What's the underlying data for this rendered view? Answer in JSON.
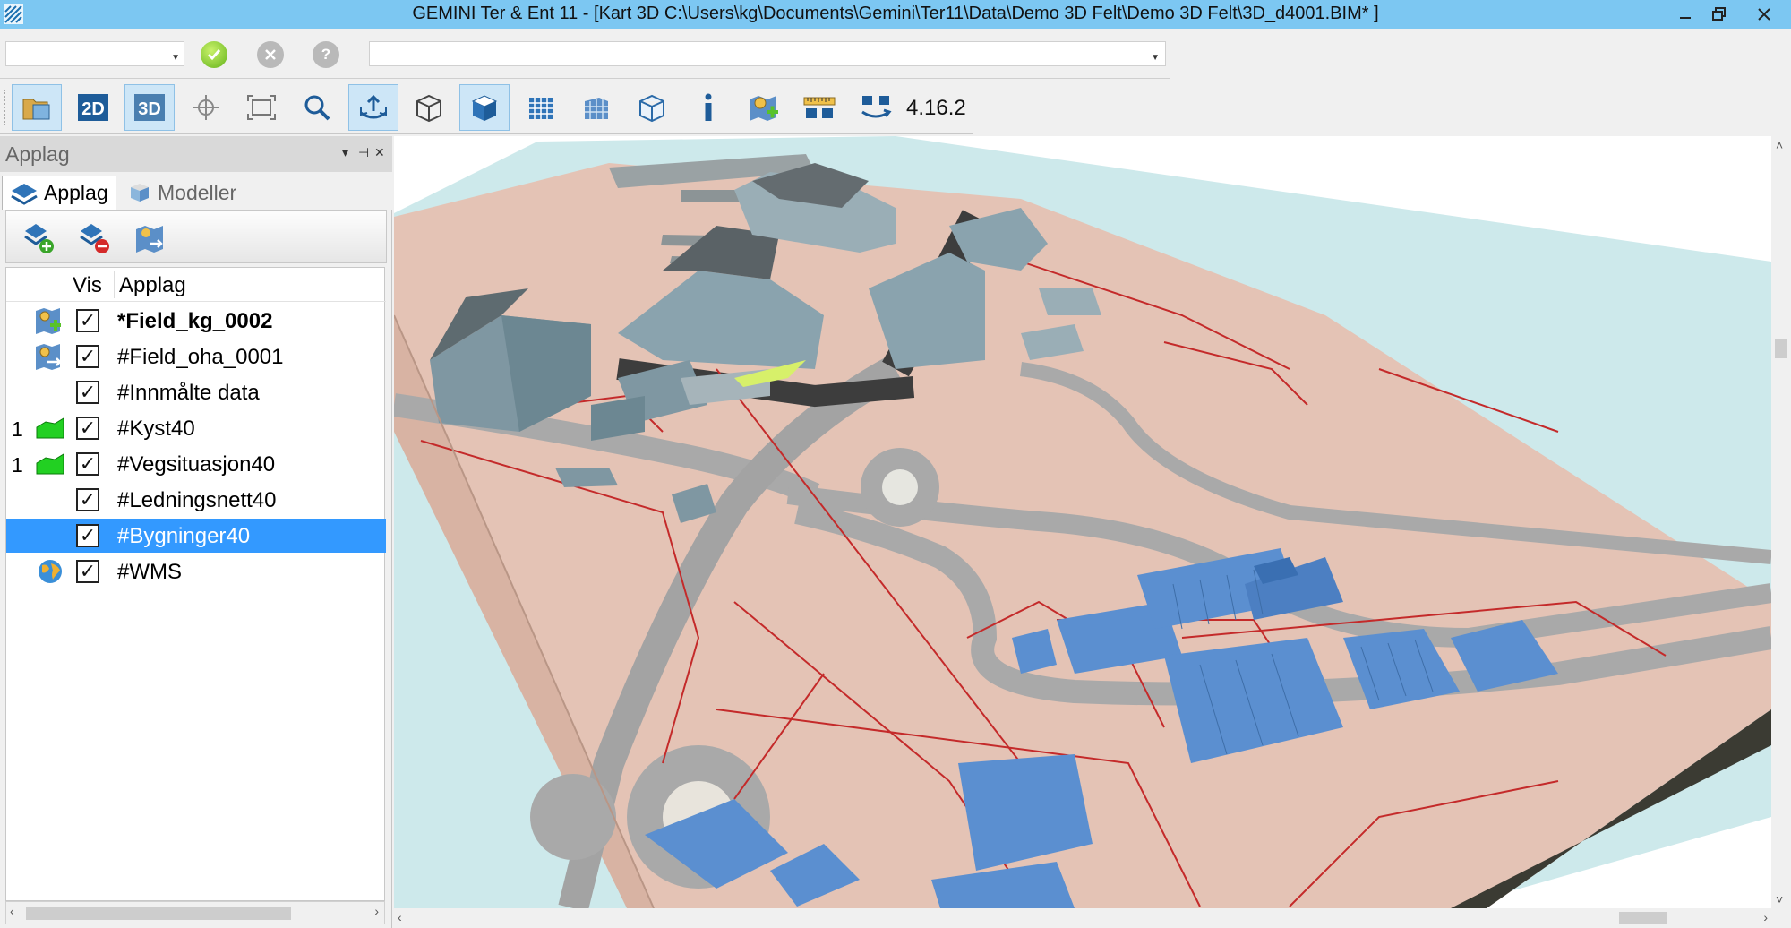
{
  "window": {
    "title": "GEMINI Ter & Ent 11 - [Kart  3D  C:\\Users\\kg\\Documents\\Gemini\\Ter11\\Data\\Demo 3D Felt\\Demo 3D Felt\\3D_d4001.BIM* ]",
    "controls": [
      "minimize",
      "restore",
      "close"
    ]
  },
  "command_bar": {
    "combo_value": "",
    "input_value": ""
  },
  "toolbar": {
    "buttons": [
      "open-folder",
      "2D",
      "3D",
      "crosshair",
      "zoom-extent",
      "zoom",
      "rotate-view",
      "box-wire",
      "box-solid",
      "grid-box",
      "grid-box-2",
      "box-outline",
      "info",
      "add-field-layer",
      "measure",
      "swap-level"
    ],
    "labels": {
      "btn_2d": "2D",
      "btn_3d": "3D"
    },
    "version": "4.16.2"
  },
  "panel": {
    "title": "Applag",
    "tabs": [
      {
        "label": "Applag",
        "active": true
      },
      {
        "label": "Modeller",
        "active": false
      }
    ],
    "columns": {
      "vis": "Vis",
      "name": "Applag"
    },
    "layers": [
      {
        "num": "",
        "icon": "field-edit-icon",
        "checked": true,
        "name": "*Field_kg_0002",
        "bold": true,
        "selected": false
      },
      {
        "num": "",
        "icon": "field-link-icon",
        "checked": true,
        "name": "#Field_oha_0001",
        "bold": false,
        "selected": false
      },
      {
        "num": "",
        "icon": "",
        "checked": true,
        "name": "#Innmålte data",
        "bold": false,
        "selected": false
      },
      {
        "num": "1",
        "icon": "terrain-green-icon",
        "checked": true,
        "name": "#Kyst40",
        "bold": false,
        "selected": false
      },
      {
        "num": "1",
        "icon": "terrain-green-icon",
        "checked": true,
        "name": "#Vegsituasjon40",
        "bold": false,
        "selected": false
      },
      {
        "num": "",
        "icon": "",
        "checked": true,
        "name": "#Ledningsnett40",
        "bold": false,
        "selected": false
      },
      {
        "num": "",
        "icon": "",
        "checked": true,
        "name": "#Bygninger40",
        "bold": false,
        "selected": true
      },
      {
        "num": "",
        "icon": "globe-icon",
        "checked": true,
        "name": "#WMS",
        "bold": false,
        "selected": false
      }
    ]
  },
  "colors": {
    "titlebar": "#7cc7f2",
    "selection": "#3399ff",
    "water": "#cbe8ea",
    "ground": "#e3c2b4",
    "road": "#a9a9a9",
    "building_gray": "#8fa9b3",
    "building_blue": "#5b8fd0"
  }
}
